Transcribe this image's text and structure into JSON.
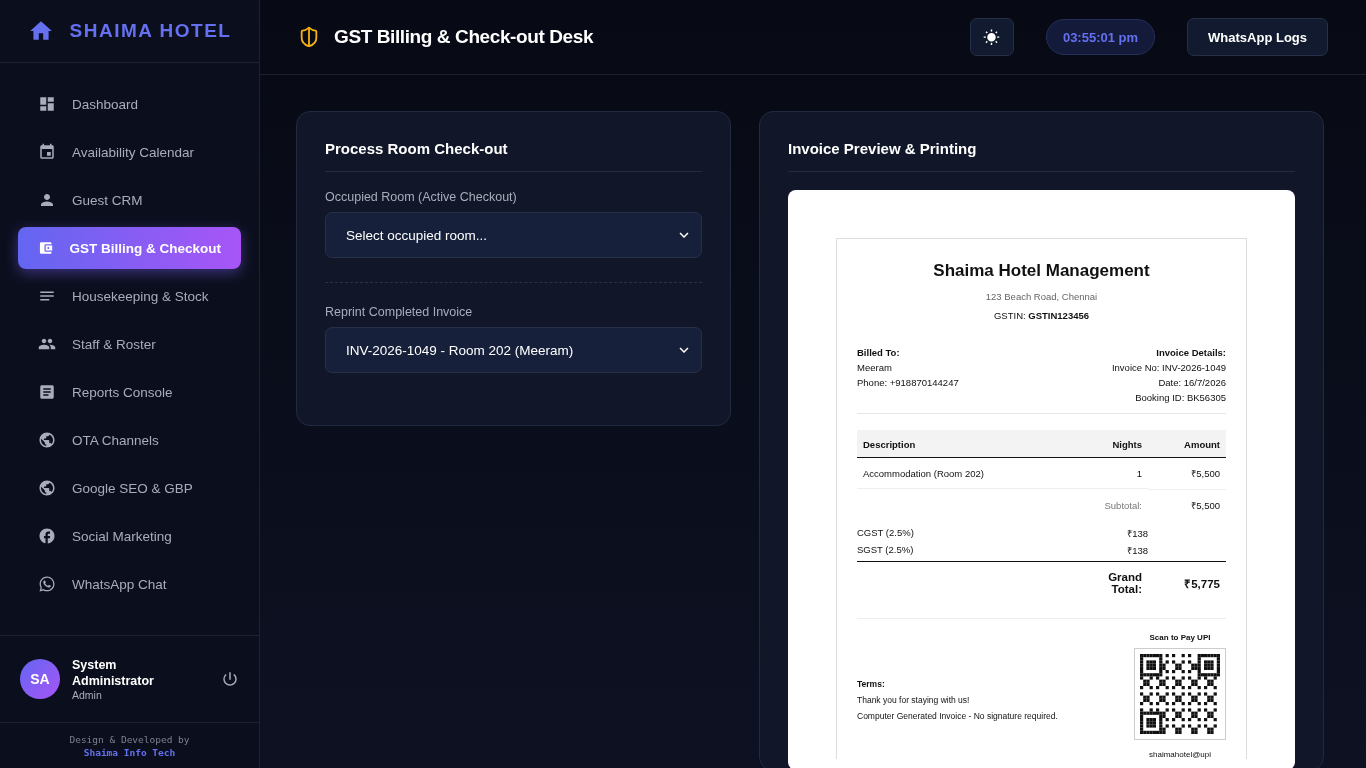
{
  "brand": {
    "name": "SHAIMA HOTEL"
  },
  "nav": [
    {
      "label": "Dashboard",
      "selected": false
    },
    {
      "label": "Availability Calendar",
      "selected": false
    },
    {
      "label": "Guest CRM",
      "selected": false
    },
    {
      "label": "GST Billing & Checkout",
      "selected": true
    },
    {
      "label": "Housekeeping & Stock",
      "selected": false
    },
    {
      "label": "Staff & Roster",
      "selected": false
    },
    {
      "label": "Reports Console",
      "selected": false
    },
    {
      "label": "OTA Channels",
      "selected": false
    },
    {
      "label": "Google SEO & GBP",
      "selected": false
    },
    {
      "label": "Social Marketing",
      "selected": false
    },
    {
      "label": "WhatsApp Chat",
      "selected": false
    }
  ],
  "user": {
    "initials": "SA",
    "name": "System Administrator",
    "role": "Admin"
  },
  "credit": {
    "line": "Design & Developed by",
    "company": "Shaima Info Tech"
  },
  "header": {
    "title": "GST Billing & Check-out Desk",
    "clock": "03:55:01 pm",
    "logs_button": "WhatsApp Logs"
  },
  "checkout": {
    "title": "Process Room Check-out",
    "fields": [
      {
        "label": "Occupied Room (Active Checkout)",
        "value": "Select occupied room..."
      },
      {
        "label": "Reprint Completed Invoice",
        "value": "INV-2026-1049 - Room 202 (Meeram)"
      }
    ]
  },
  "preview": {
    "title": "Invoice Preview & Printing",
    "invoice": {
      "hotel": "Shaima Hotel Management",
      "address": "123 Beach Road, Chennai",
      "gstin": "GSTIN: **GSTIN123456**",
      "billed_heading": "Billed To:",
      "billed_lines": [
        "Meeram",
        "Phone: +918870144247"
      ],
      "details_heading": "Invoice Details:",
      "details_lines": [
        "Invoice No: INV-2026-1049",
        "Date: 16/7/2026",
        "Booking ID: BK56305"
      ],
      "columns": [
        "Description",
        "Nights",
        "Amount"
      ],
      "rows": [
        {
          "description": "Accommodation (Room 202)",
          "nights": "1",
          "amount": "₹5,500"
        }
      ],
      "subtotal": {
        "label": "Subtotal:",
        "value": "₹5,500"
      },
      "taxes": [
        {
          "label": "CGST (2.5%)",
          "value": "₹138"
        },
        {
          "label": "SGST (2.5%)",
          "value": "₹138"
        }
      ],
      "grand_total": {
        "label": "Grand Total:",
        "value": "₹5,775"
      },
      "terms_heading": "Terms:",
      "terms_lines": [
        "Thank you for staying with us!",
        "Computer Generated Invoice - No signature required."
      ],
      "qr_caption": "Scan to Pay UPI",
      "upi": "shaimahotel@upi"
    }
  }
}
